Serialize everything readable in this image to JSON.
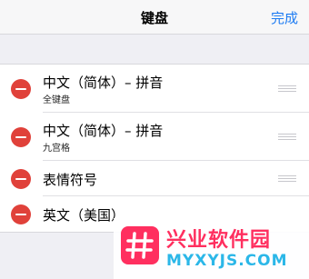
{
  "navbar": {
    "title": "键盘",
    "done_label": "完成"
  },
  "keyboards": [
    {
      "title": "中文（简体）– 拼音",
      "subtitle": "全键盘"
    },
    {
      "title": "中文（简体）– 拼音",
      "subtitle": "九宫格"
    },
    {
      "title": "表情符号"
    },
    {
      "title": "英文（美国）"
    }
  ],
  "watermark": {
    "text": "兴业软件园",
    "url": "MYXYJS.COM"
  },
  "colors": {
    "accent": "#1e7cf2",
    "delete": "#e0413a",
    "watermark_pink": "#ff2f5f",
    "watermark_blue": "#2bb7e8"
  }
}
